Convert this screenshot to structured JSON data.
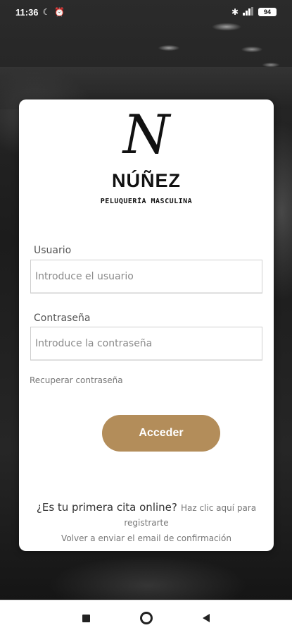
{
  "status_bar": {
    "time": "11:36",
    "left_icons": [
      "moon-icon",
      "alarm-icon"
    ],
    "right_icons": [
      "bluetooth-icon",
      "signal-icon"
    ],
    "battery": "94"
  },
  "brand": {
    "logo_letter": "N",
    "name": "NÚÑEZ",
    "tagline": "PELUQUERÍA MASCULINA"
  },
  "login_form": {
    "username_label": "Usuario",
    "username_placeholder": "Introduce el usuario",
    "password_label": "Contraseña",
    "password_placeholder": "Introduce la contraseña",
    "recover_link": "Recuperar contraseña",
    "submit_label": "Acceder"
  },
  "footer": {
    "first_visit_question": "¿Es tu primera cita online?",
    "first_visit_link": "Haz clic aquí para registrarte",
    "resend_link": "Volver a enviar el email de confirmación"
  },
  "colors": {
    "accent": "#b38d5a",
    "card_bg": "#ffffff",
    "background": "#1c1c1c"
  },
  "nav_bar": {
    "icons": [
      "recents-square-icon",
      "home-circle-icon",
      "back-triangle-icon"
    ]
  }
}
